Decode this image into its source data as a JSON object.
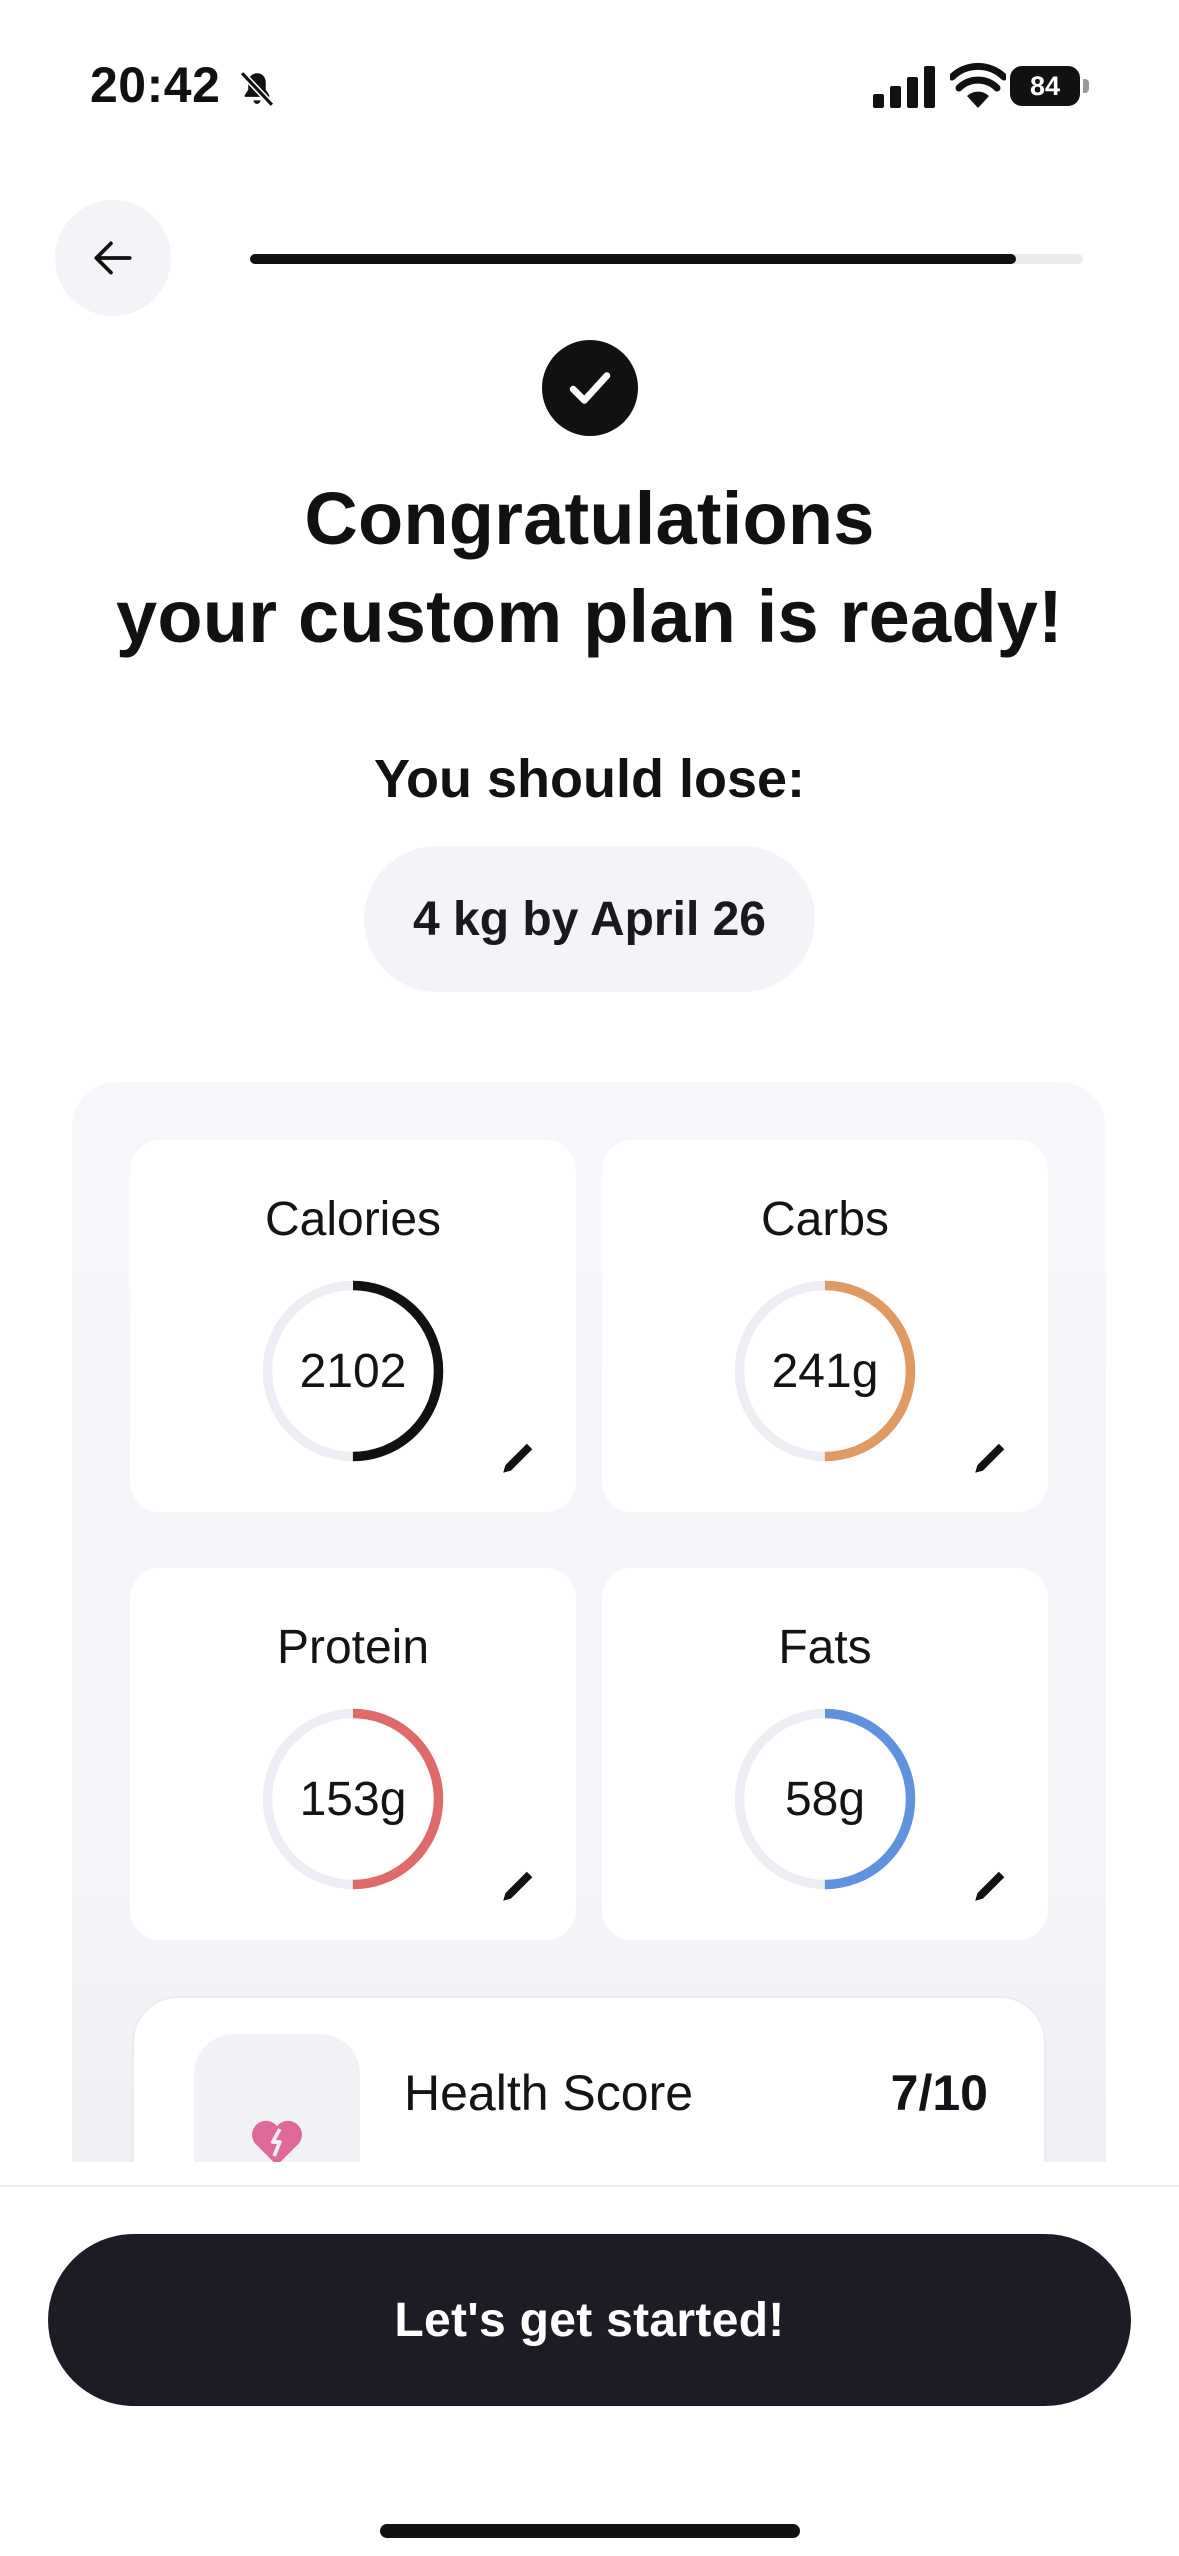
{
  "status_bar": {
    "time": "20:42",
    "battery": "84",
    "icons": [
      "bell-slash-icon",
      "cellular-signal-icon",
      "wifi-icon",
      "battery-icon"
    ]
  },
  "header": {
    "back_icon": "arrow-left-icon",
    "progress_fraction": 0.92
  },
  "hero": {
    "check_icon": "checkmark-icon",
    "title_line1": "Congratulations",
    "title_line2": "your custom plan is ready!",
    "lose_label": "You should lose:",
    "goal": "4 kg by April 26"
  },
  "macros": [
    {
      "label": "Calories",
      "value": "2102",
      "ring_fraction": 0.5,
      "color": "#111114"
    },
    {
      "label": "Carbs",
      "value": "241g",
      "ring_fraction": 0.5,
      "color": "#e09a62"
    },
    {
      "label": "Protein",
      "value": "153g",
      "ring_fraction": 0.5,
      "color": "#e06a6a"
    },
    {
      "label": "Fats",
      "value": "58g",
      "ring_fraction": 0.5,
      "color": "#5f93e0"
    }
  ],
  "ring_track_color": "#ededf4",
  "health": {
    "icon": "broken-heart-icon",
    "icon_color": "#e0679a",
    "label": "Health Score",
    "value": "7/10"
  },
  "cta": {
    "label": "Let's get started!"
  }
}
